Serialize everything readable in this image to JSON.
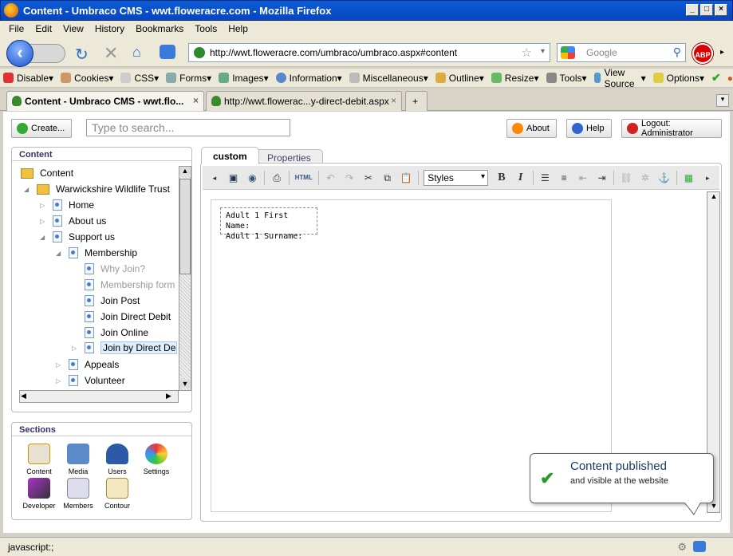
{
  "window": {
    "title": "Content - Umbraco CMS - wwt.floweracre.com - Mozilla Firefox"
  },
  "menu": [
    "File",
    "Edit",
    "View",
    "History",
    "Bookmarks",
    "Tools",
    "Help"
  ],
  "nav": {
    "url": "http://wwt.floweracre.com/umbraco/umbraco.aspx#content",
    "search_placeholder": "Google",
    "abp": "ABP"
  },
  "devbar": [
    "Disable",
    "Cookies",
    "CSS",
    "Forms",
    "Images",
    "Information",
    "Miscellaneous",
    "Outline",
    "Resize",
    "Tools",
    "View Source",
    "Options"
  ],
  "tabs": [
    {
      "label": "Content - Umbraco CMS - wwt.flo..."
    },
    {
      "label": "http://wwt.flowerac...y-direct-debit.aspx"
    }
  ],
  "header": {
    "create": "Create...",
    "search_placeholder": "Type to search...",
    "about": "About",
    "help": "Help",
    "logout": "Logout: Administrator"
  },
  "content_panel": {
    "title": "Content"
  },
  "tree": [
    {
      "label": "Content"
    },
    {
      "label": "Warwickshire Wildlife Trust"
    },
    {
      "label": "Home"
    },
    {
      "label": "About us"
    },
    {
      "label": "Support us"
    },
    {
      "label": "Membership"
    },
    {
      "label": "Why Join?"
    },
    {
      "label": "Membership form"
    },
    {
      "label": "Join Post"
    },
    {
      "label": "Join Direct Debit"
    },
    {
      "label": "Join Online"
    },
    {
      "label": "Join by Direct Debit"
    },
    {
      "label": "Appeals"
    },
    {
      "label": "Volunteer"
    }
  ],
  "sections": {
    "title": "Sections",
    "items": [
      "Content",
      "Media",
      "Users",
      "Settings",
      "Developer",
      "Members",
      "Contour"
    ]
  },
  "editor": {
    "tab_custom": "custom",
    "tab_properties": "Properties",
    "styles": "Styles",
    "html_btn": "HTML",
    "bold": "B",
    "italic": "I",
    "field1": "Adult 1 First Name:",
    "field2": "Adult 1 Surname:"
  },
  "notification": {
    "title": "Content published",
    "body": "and visible at the website"
  },
  "status": {
    "text": "javascript:;"
  }
}
